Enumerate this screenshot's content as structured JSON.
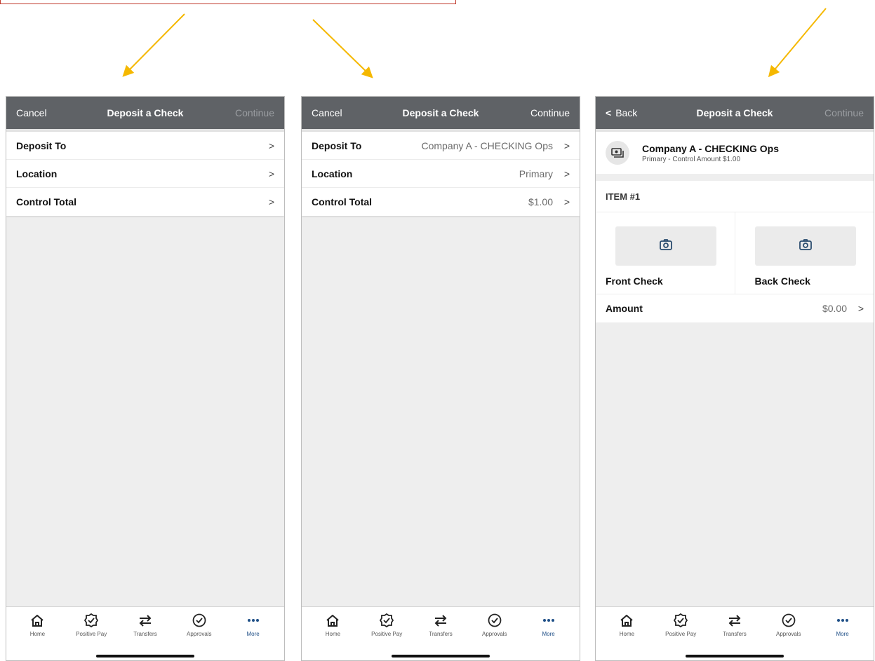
{
  "colors": {
    "nav_bg": "#5f6266",
    "arrow": "#f5b800",
    "accent": "#1f4f87",
    "callout_border": "#c0392b"
  },
  "tabs": [
    {
      "label": "Home",
      "icon": "home-icon"
    },
    {
      "label": "Positive Pay",
      "icon": "shield-check-icon"
    },
    {
      "label": "Transfers",
      "icon": "transfer-arrows-icon"
    },
    {
      "label": "Approvals",
      "icon": "check-circle-icon"
    },
    {
      "label": "More",
      "icon": "more-dots-icon",
      "active": true
    }
  ],
  "screens": [
    {
      "nav": {
        "left": "Cancel",
        "title": "Deposit a Check",
        "right": "Continue",
        "right_enabled": false
      },
      "rows": [
        {
          "label": "Deposit To",
          "value": ""
        },
        {
          "label": "Location",
          "value": ""
        },
        {
          "label": "Control Total",
          "value": ""
        }
      ]
    },
    {
      "nav": {
        "left": "Cancel",
        "title": "Deposit a Check",
        "right": "Continue",
        "right_enabled": true
      },
      "rows": [
        {
          "label": "Deposit To",
          "value": "Company A - CHECKING Ops"
        },
        {
          "label": "Location",
          "value": "Primary"
        },
        {
          "label": "Control Total",
          "value": "$1.00"
        }
      ]
    },
    {
      "nav": {
        "left": "Back",
        "title": "Deposit a Check",
        "right": "Continue",
        "right_enabled": false
      },
      "account": {
        "name": "Company A - CHECKING Ops",
        "sub": "Primary - Control Amount $1.00"
      },
      "item_header": "ITEM #1",
      "front_label": "Front Check",
      "back_label": "Back Check",
      "amount": {
        "label": "Amount",
        "value": "$0.00"
      }
    }
  ]
}
